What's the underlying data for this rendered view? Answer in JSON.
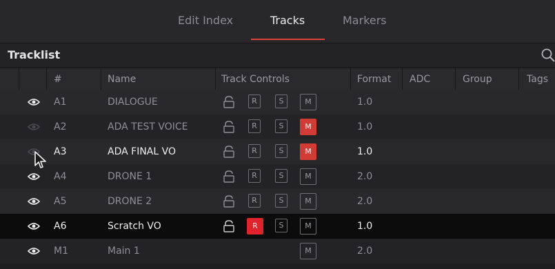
{
  "tabs": [
    {
      "label": "Edit Index",
      "active": false
    },
    {
      "label": "Tracks",
      "active": true
    },
    {
      "label": "Markers",
      "active": false
    }
  ],
  "section": {
    "title": "Tracklist",
    "search_icon": "search-icon"
  },
  "columns": [
    "#",
    "Name",
    "Track Controls",
    "Format",
    "ADC",
    "Group",
    "Tags"
  ],
  "button_labels": {
    "record": "R",
    "solo": "S",
    "mute": "M"
  },
  "tracks": [
    {
      "num": "A1",
      "name": "DIALOGUE",
      "format": "1.0",
      "visible": true,
      "locked": false,
      "record": false,
      "solo": false,
      "mute": false
    },
    {
      "num": "A2",
      "name": "ADA TEST VOICE",
      "format": "1.0",
      "visible": false,
      "locked": false,
      "record": false,
      "solo": false,
      "mute": true
    },
    {
      "num": "A3",
      "name": "ADA FINAL VO",
      "format": "1.0",
      "visible": false,
      "locked": false,
      "record": false,
      "solo": false,
      "mute": true
    },
    {
      "num": "A4",
      "name": "DRONE 1",
      "format": "2.0",
      "visible": true,
      "locked": false,
      "record": false,
      "solo": false,
      "mute": false
    },
    {
      "num": "A5",
      "name": "DRONE 2",
      "format": "2.0",
      "visible": true,
      "locked": false,
      "record": false,
      "solo": false,
      "mute": false
    },
    {
      "num": "A6",
      "name": "Scratch VO",
      "format": "1.0",
      "visible": true,
      "locked": false,
      "record": true,
      "solo": false,
      "mute": false
    },
    {
      "num": "M1",
      "name": "Main 1",
      "format": "2.0",
      "visible": true,
      "locked": false,
      "record": false,
      "solo": false,
      "mute": false
    }
  ],
  "colors": {
    "accent": "#e0443d",
    "mute_on": "#d33b35",
    "record_on": "#e0232a",
    "background": "#1e1e20"
  }
}
